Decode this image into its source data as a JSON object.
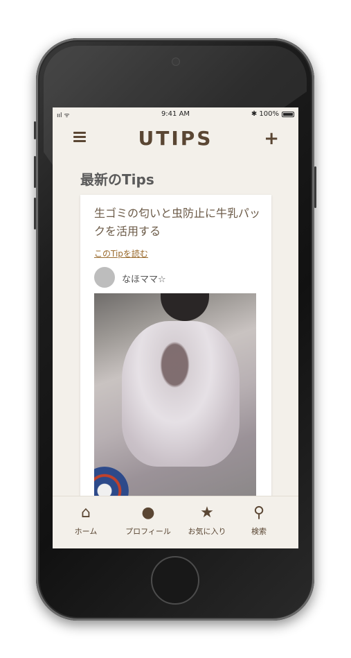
{
  "status_bar": {
    "signal": "ııl ᯤ",
    "time": "9:41 AM",
    "battery": "✱ 100%"
  },
  "app_bar": {
    "logo": "UTIPS",
    "add_label": "+"
  },
  "section": {
    "title": "最新のTips"
  },
  "card": {
    "title": "生ゴミの匂いと虫防止に牛乳パックを活用する",
    "link": "このTipを読む",
    "author": "なほママ☆"
  },
  "tab_bar": {
    "items": [
      {
        "icon": "home-icon",
        "glyph": "⌂",
        "label": "ホーム"
      },
      {
        "icon": "user-icon",
        "glyph": "●",
        "label": "プロフィール"
      },
      {
        "icon": "star-icon",
        "glyph": "★",
        "label": "お気に入り"
      },
      {
        "icon": "search-icon",
        "glyph": "⚲",
        "label": "検索"
      }
    ]
  },
  "colors": {
    "brand": "#5a4633",
    "accent_link": "#9a6b2e",
    "background": "#f3f0ea"
  }
}
